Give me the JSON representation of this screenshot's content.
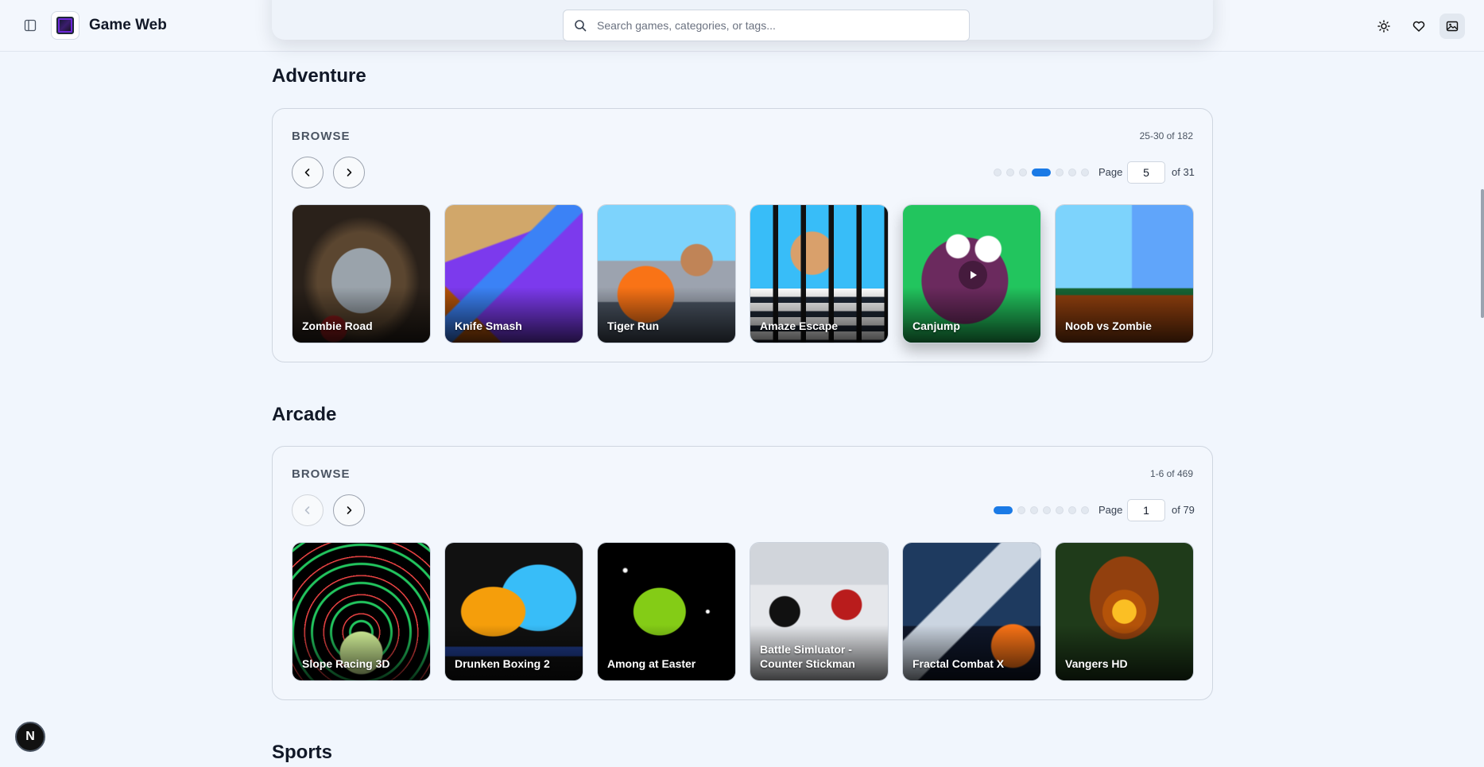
{
  "app": {
    "title": "Game Web"
  },
  "search": {
    "placeholder": "Search games, categories, or tags..."
  },
  "sections": [
    {
      "title": "Adventure",
      "browse_label": "BROWSE",
      "range": "25-30 of 182",
      "page_label": "Page",
      "page_value": "5",
      "page_of": "of 31",
      "games": [
        "Zombie Road",
        "Knife Smash",
        "Tiger Run",
        "Amaze Escape",
        "Canjump",
        "Noob vs Zombie"
      ]
    },
    {
      "title": "Arcade",
      "browse_label": "BROWSE",
      "range": "1-6 of 469",
      "page_label": "Page",
      "page_value": "1",
      "page_of": "of 79",
      "games": [
        "Slope Racing 3D",
        "Drunken Boxing 2",
        "Among at Easter",
        "Battle Simluator - Counter Stickman",
        "Fractal Combat X",
        "Vangers HD"
      ]
    },
    {
      "title": "Sports"
    }
  ],
  "fab": {
    "label": "N"
  },
  "icons": [
    "sidebar-toggle-icon",
    "search-icon",
    "sun-icon",
    "heart-icon",
    "image-icon",
    "chevron-left-icon",
    "chevron-right-icon",
    "play-icon"
  ],
  "colors": {
    "accent": "#1a7ae6",
    "background": "#f1f6fd"
  }
}
